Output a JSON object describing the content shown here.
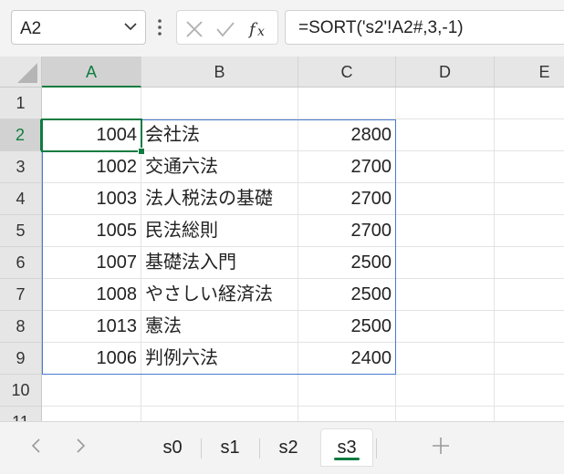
{
  "name_box": {
    "value": "A2"
  },
  "formula_bar": {
    "formula": "=SORT('s2'!A2#,3,-1)"
  },
  "columns": [
    "A",
    "B",
    "C",
    "D",
    "E"
  ],
  "rows": [
    "1",
    "2",
    "3",
    "4",
    "5",
    "6",
    "7",
    "8",
    "9",
    "10",
    "11"
  ],
  "cells": [
    {
      "id": "1004",
      "title": "会社法",
      "price": "2800"
    },
    {
      "id": "1002",
      "title": "交通六法",
      "price": "2700"
    },
    {
      "id": "1003",
      "title": "法人税法の基礎",
      "price": "2700"
    },
    {
      "id": "1005",
      "title": "民法総則",
      "price": "2700"
    },
    {
      "id": "1007",
      "title": "基礎法入門",
      "price": "2500"
    },
    {
      "id": "1008",
      "title": "やさしい経済法",
      "price": "2500"
    },
    {
      "id": "1013",
      "title": "憲法",
      "price": "2500"
    },
    {
      "id": "1006",
      "title": "判例六法",
      "price": "2400"
    }
  ],
  "sheet_tabs": [
    "s0",
    "s1",
    "s2",
    "s3"
  ],
  "active_sheet": "s3",
  "colors": {
    "accent": "#107c41",
    "spill_border": "#4a7bd0"
  }
}
